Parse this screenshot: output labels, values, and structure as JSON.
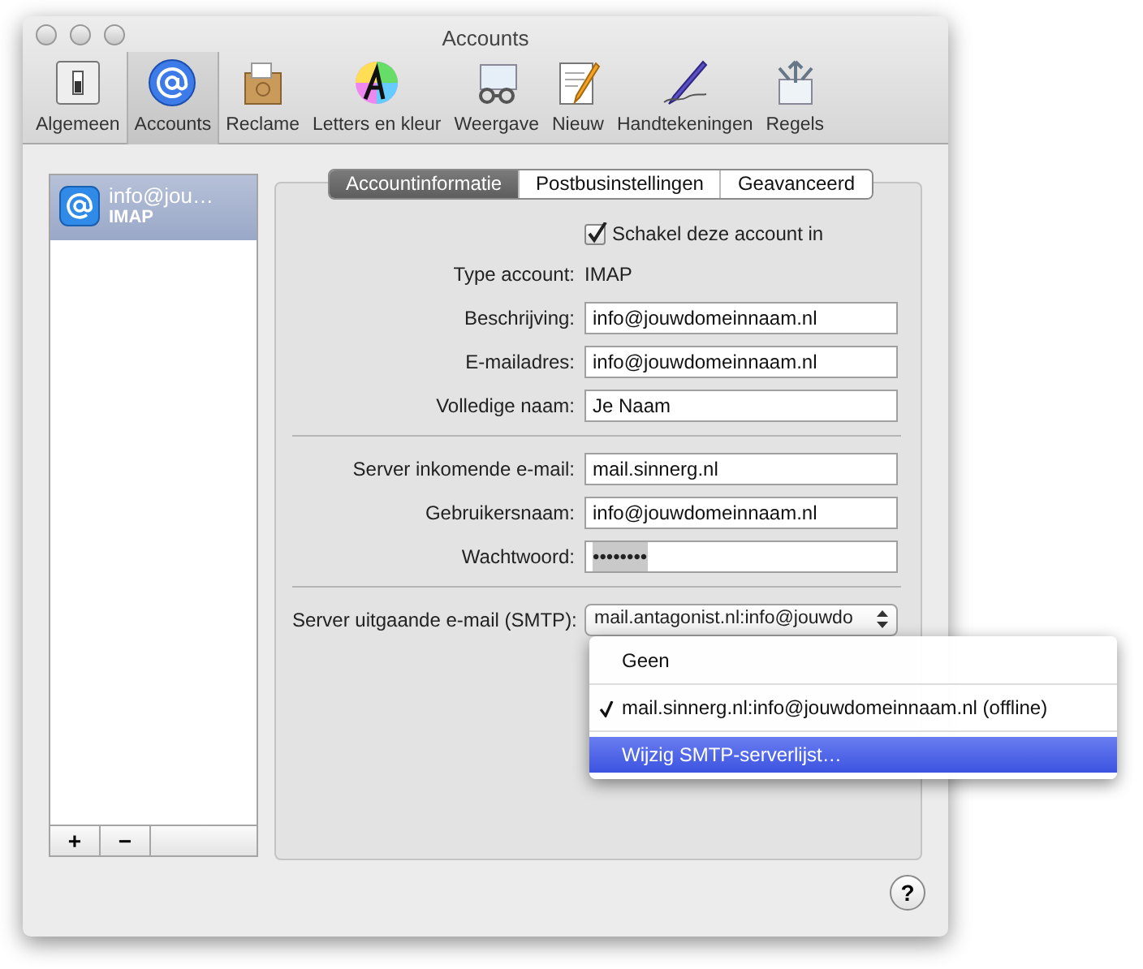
{
  "window": {
    "title": "Accounts"
  },
  "toolbar": [
    {
      "label": "Algemeen",
      "selected": false
    },
    {
      "label": "Accounts",
      "selected": true
    },
    {
      "label": "Reclame",
      "selected": false
    },
    {
      "label": "Letters en kleur",
      "selected": false
    },
    {
      "label": "Weergave",
      "selected": false
    },
    {
      "label": "Nieuw",
      "selected": false
    },
    {
      "label": "Handtekeningen",
      "selected": false
    },
    {
      "label": "Regels",
      "selected": false
    }
  ],
  "accounts": [
    {
      "name": "info@jou…",
      "type": "IMAP",
      "selected": true
    }
  ],
  "list_buttons": [
    "+",
    "−"
  ],
  "tabs": [
    {
      "label": "Accountinformatie",
      "selected": true
    },
    {
      "label": "Postbusinstellingen",
      "selected": false
    },
    {
      "label": "Geavanceerd",
      "selected": false
    }
  ],
  "enable_checkbox": {
    "label": "Schakel deze account in",
    "checked": true
  },
  "sections": [
    [
      {
        "kind": "static",
        "label": "Type account:",
        "value": "IMAP"
      },
      {
        "kind": "text",
        "label": "Beschrijving:",
        "value": "info@jouwdomeinnaam.nl"
      },
      {
        "kind": "text",
        "label": "E-mailadres:",
        "value": "info@jouwdomeinnaam.nl"
      },
      {
        "kind": "text",
        "label": "Volledige naam:",
        "value": "Je Naam"
      }
    ],
    [
      {
        "kind": "text",
        "label": "Server inkomende e-mail:",
        "value": "mail.sinnerg.nl"
      },
      {
        "kind": "text",
        "label": "Gebruikersnaam:",
        "value": "info@jouwdomeinnaam.nl"
      },
      {
        "kind": "password",
        "label": "Wachtwoord:",
        "value": "••••••••"
      }
    ]
  ],
  "smtp": {
    "label": "Server uitgaande e-mail (SMTP):",
    "value": "mail.antagonist.nl:info@jouwdo"
  },
  "smtp_menu": [
    {
      "label": "Geen",
      "checked": false,
      "selected": false
    },
    {
      "label": "mail.sinnerg.nl:info@jouwdomeinnaam.nl (offline)",
      "checked": true,
      "selected": false
    },
    {
      "label": "Wijzig SMTP-serverlijst…",
      "checked": false,
      "selected": true
    }
  ],
  "help": "?"
}
